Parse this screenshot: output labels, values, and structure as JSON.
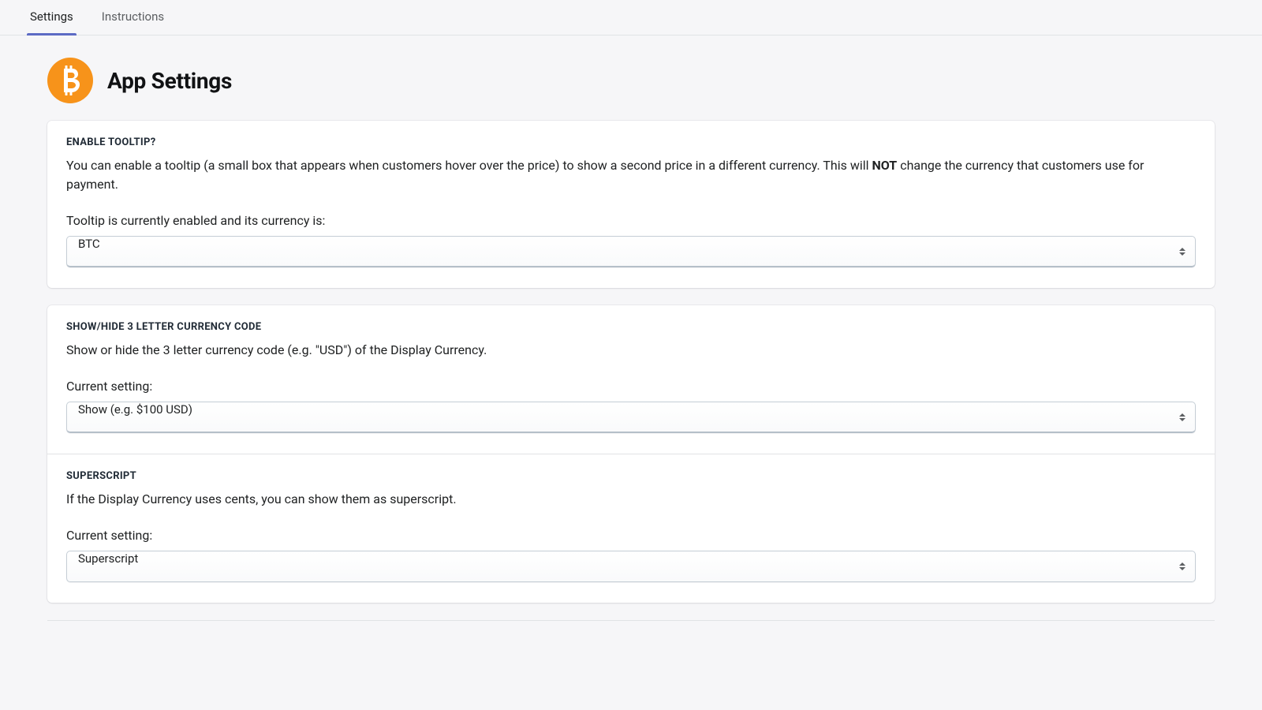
{
  "tabs": {
    "settings": "Settings",
    "instructions": "Instructions"
  },
  "header": {
    "title": "App Settings",
    "icon": "bitcoin-icon"
  },
  "tooltip_section": {
    "heading": "ENABLE TOOLTIP?",
    "desc_pre": "You can enable a tooltip (a small box that appears when customers hover over the price) to show a second price in a different currency. This will ",
    "desc_strong": "NOT",
    "desc_post": " change the currency that customers use for payment.",
    "field_label": "Tooltip is currently enabled and its currency is:",
    "value": "BTC"
  },
  "currency_code_section": {
    "heading": "SHOW/HIDE 3 LETTER CURRENCY CODE",
    "desc": "Show or hide the 3 letter currency code (e.g. \"USD\") of the Display Currency.",
    "field_label": "Current setting:",
    "value": "Show (e.g. $100 USD)"
  },
  "superscript_section": {
    "heading": "SUPERSCRIPT",
    "desc": "If the Display Currency uses cents, you can show them as superscript.",
    "field_label": "Current setting:",
    "value": "Superscript"
  }
}
